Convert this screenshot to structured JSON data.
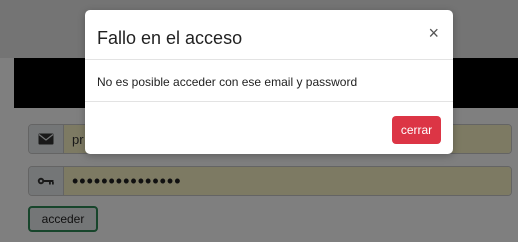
{
  "form": {
    "email": {
      "value": "pr",
      "icon": "envelope-icon"
    },
    "password": {
      "masked_value": "•••••••••••••••",
      "icon": "key-icon"
    },
    "submit_label": "acceder"
  },
  "modal": {
    "title": "Fallo en el acceso",
    "close_symbol": "×",
    "message": "No es posible acceder con ese email y password",
    "close_button_label": "cerrar"
  },
  "colors": {
    "overlay": "rgba(0,0,0,0.5)",
    "danger": "#dc3545",
    "input_fill": "#fbf4c6",
    "success_border": "#2e8b57"
  }
}
